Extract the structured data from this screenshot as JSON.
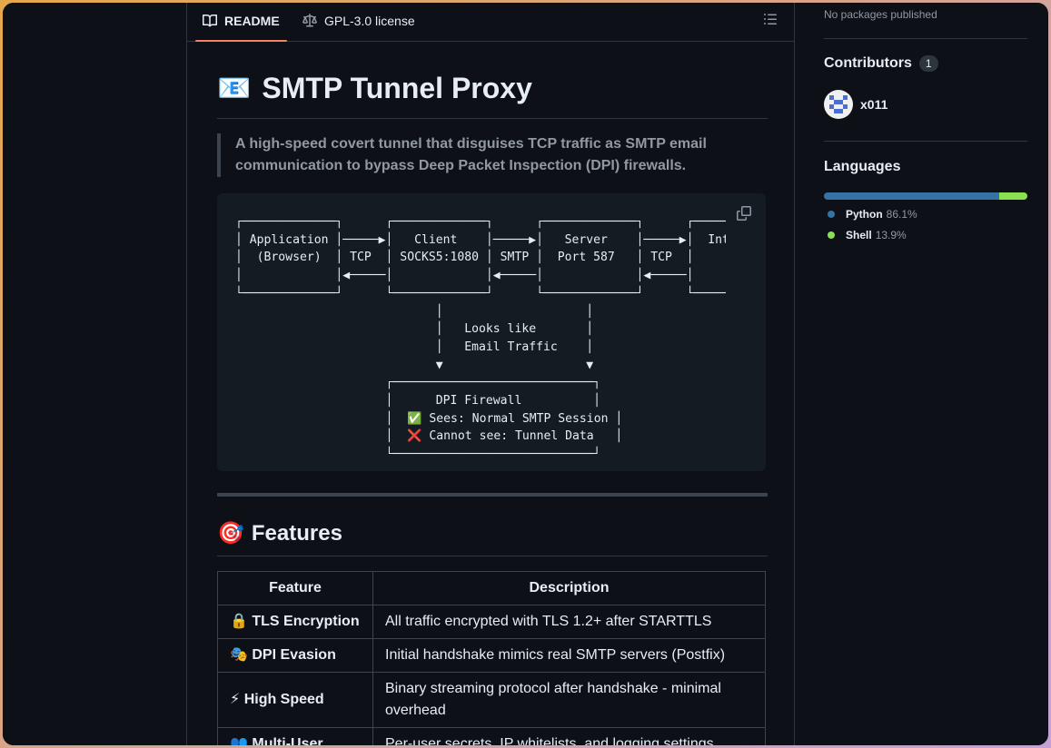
{
  "tabs": {
    "readme": "README",
    "license": "GPL-3.0 license"
  },
  "readme": {
    "title_emoji": "📧",
    "title": "SMTP Tunnel Proxy",
    "tagline": "A high-speed covert tunnel that disguises TCP traffic as SMTP email communication to bypass Deep Packet Inspection (DPI) firewalls.",
    "diagram": "┌─────────────┐      ┌─────────────┐      ┌─────────────┐      ┌─────────────┐\n│ Application │─────▶│   Client    │─────▶│   Server    │─────▶│  Internet   │\n│  (Browser)  │ TCP  │ SOCKS5:1080 │ SMTP │  Port 587   │ TCP  │             │\n│             │◀─────│             │◀─────│             │◀─────│             │\n└─────────────┘      └─────────────┘      └─────────────┘      └─────────────┘\n                            │                    │\n                            │   Looks like       │\n                            │   Email Traffic    │\n                            ▼                    ▼\n                     ┌────────────────────────────┐\n                     │      DPI Firewall          │\n                     │  ✅ Sees: Normal SMTP Session │\n                     │  ❌ Cannot see: Tunnel Data   │\n                     └────────────────────────────┘",
    "features_emoji": "🎯",
    "features_heading": "Features",
    "table": {
      "headers": [
        "Feature",
        "Description"
      ],
      "rows": [
        {
          "icon": "🔒",
          "feature": "TLS Encryption",
          "description": "All traffic encrypted with TLS 1.2+ after STARTTLS"
        },
        {
          "icon": "🎭",
          "feature": "DPI Evasion",
          "description": "Initial handshake mimics real SMTP servers (Postfix)"
        },
        {
          "icon": "⚡",
          "feature": "High Speed",
          "description": "Binary streaming protocol after handshake - minimal overhead"
        },
        {
          "icon": "👥",
          "feature": "Multi-User",
          "description": "Per-user secrets, IP whitelists, and logging settings"
        }
      ]
    }
  },
  "sidebar": {
    "packages_text": "No packages published",
    "contributors_heading": "Contributors",
    "contributors_count": "1",
    "contributor_name": "x011",
    "languages_heading": "Languages",
    "languages": [
      {
        "name": "Python",
        "percent": "86.1%",
        "value": 86.1,
        "color": "#3572A5"
      },
      {
        "name": "Shell",
        "percent": "13.9%",
        "value": 13.9,
        "color": "#89e051"
      }
    ]
  }
}
